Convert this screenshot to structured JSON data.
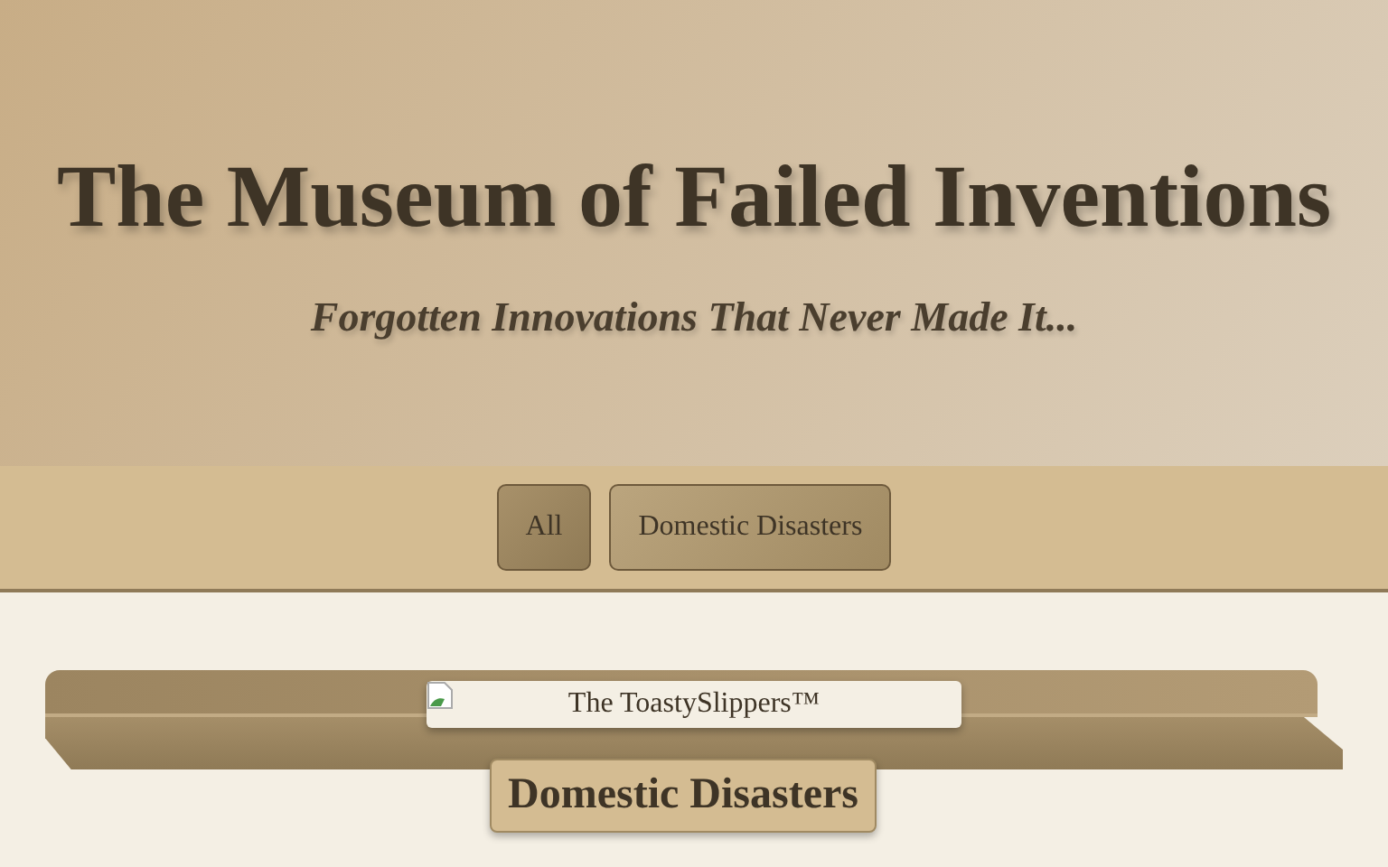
{
  "header": {
    "title": "The Museum of Failed Inventions",
    "subtitle": "Forgotten Innovations That Never Made It..."
  },
  "filters": [
    {
      "label": "All",
      "selected": true
    },
    {
      "label": "Domestic Disasters",
      "selected": false
    }
  ],
  "shelf": {
    "items": [
      {
        "kind": "picture",
        "alt": "The ToastySlippers™"
      }
    ],
    "label": "Domestic Disasters"
  }
}
